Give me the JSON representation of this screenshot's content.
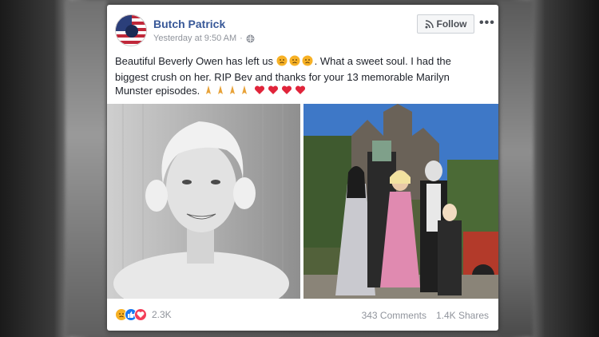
{
  "post": {
    "author": "Butch Patrick",
    "timestamp": "Yesterday at 9:50 AM",
    "privacy_icon": "globe-icon",
    "follow_label": "Follow",
    "more_label": "•••",
    "text_line1": "Beautiful Beverly Owen has left us",
    "text_line1_after": ". What a sweet soul. I had the",
    "text_line2": "biggest crush on her. RIP Bev and thanks for your 13 memorable Marilyn",
    "text_line3": "Munster episodes.",
    "emoji_sad_count": 3,
    "emoji_pray_count": 4,
    "emoji_heart_count": 4
  },
  "footer": {
    "reaction_icons": [
      "sad-reaction-icon",
      "like-reaction-icon",
      "love-reaction-icon"
    ],
    "reaction_count": "2.3K",
    "comments": "343 Comments",
    "shares": "1.4K Shares"
  },
  "colors": {
    "author_link": "#385898",
    "meta_gray": "#90949c",
    "like_blue": "#1877f2",
    "love_red": "#f33e58",
    "sad_yellow": "#f7b125"
  }
}
